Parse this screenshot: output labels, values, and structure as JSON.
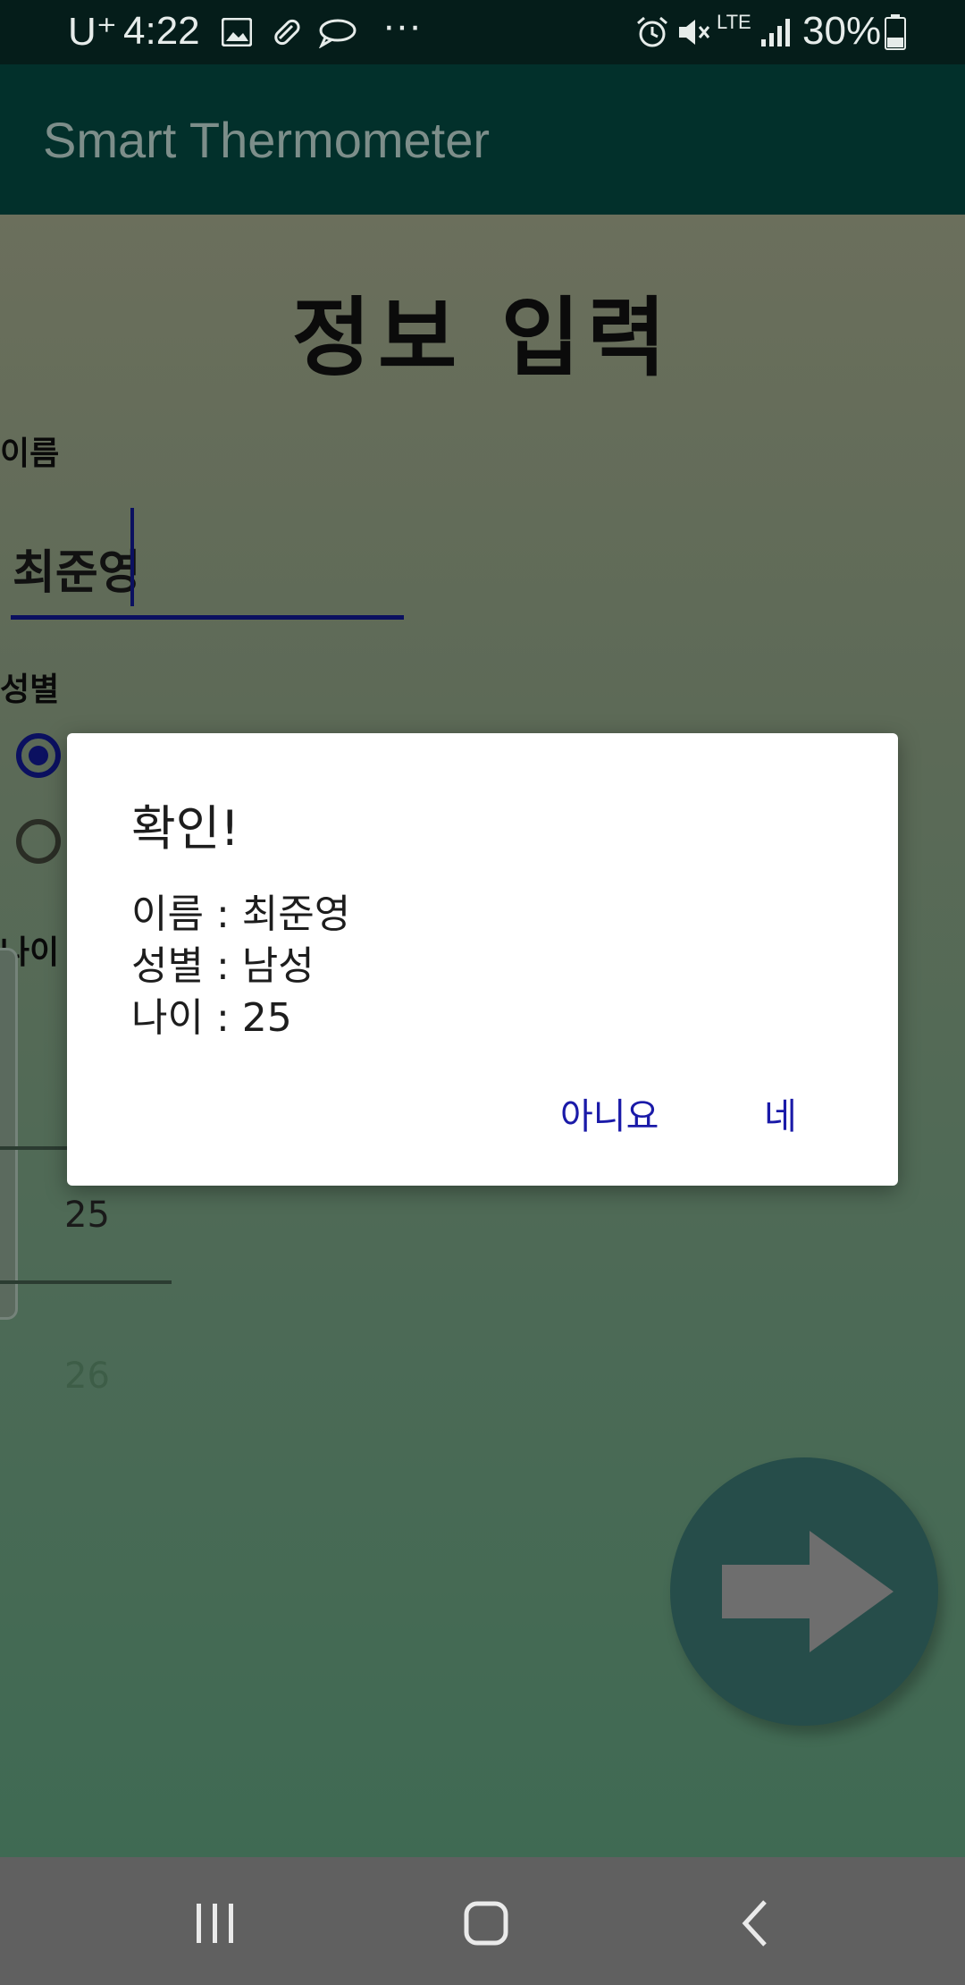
{
  "status_bar": {
    "carrier": "U⁺",
    "time": "4:22",
    "icons": [
      "gallery-icon",
      "pill-icon",
      "chat-bubble-icon",
      "more-dots-icon",
      "alarm-icon",
      "mute-icon",
      "lte-icon",
      "signal-icon",
      "battery-icon"
    ],
    "more": "···",
    "network": "LTE",
    "battery": "30%"
  },
  "app_bar": {
    "title": "Smart Thermometer"
  },
  "form": {
    "heading": "정보 입력",
    "name_label": "이름",
    "name_value": "최준영",
    "gender_label": "성별",
    "gender_selected": "남성",
    "age_label": "나이",
    "age_picker": {
      "selected": "25",
      "next": "26"
    }
  },
  "dialog": {
    "title": "확인!",
    "lines": [
      "이름 : 최준영",
      "성별 : 남성",
      "나이 : 25"
    ],
    "negative": "아니요",
    "positive": "네"
  },
  "colors": {
    "accent": "#0b1060",
    "dialog_button": "#1a1aa8",
    "app_bar": "#02302b",
    "fab": "#264d4a"
  },
  "nav_bar": {
    "icons": [
      "recent-apps-icon",
      "home-icon",
      "back-icon"
    ]
  }
}
